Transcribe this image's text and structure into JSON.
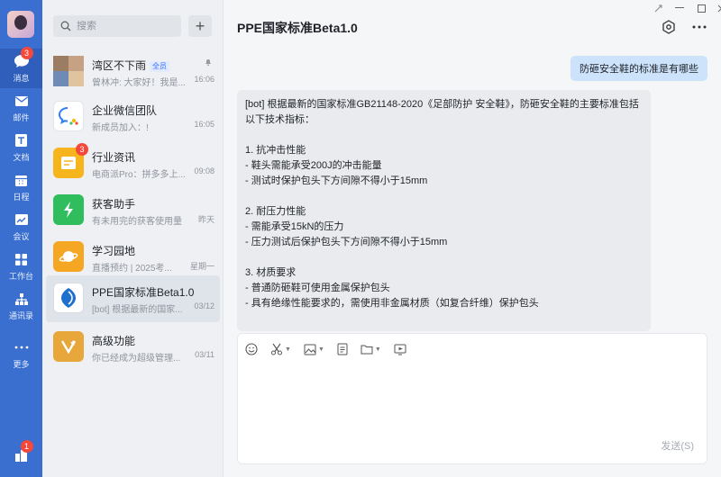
{
  "rail": {
    "items": [
      {
        "label": "消息",
        "badge": "3"
      },
      {
        "label": "邮件"
      },
      {
        "label": "文档"
      },
      {
        "label": "日程"
      },
      {
        "label": "会议"
      },
      {
        "label": "工作台"
      },
      {
        "label": "通讯录"
      },
      {
        "label": "更多"
      }
    ],
    "bottom_badge": "1",
    "accent": "#3a6fcf"
  },
  "search": {
    "placeholder": "搜索"
  },
  "add_label": "+",
  "conversations": [
    {
      "title": "湾区不下雨",
      "tag": "全员",
      "subtitle": "曾林冲: 大家好！我是...",
      "time": "16:06",
      "muted": true
    },
    {
      "title": "企业微信团队",
      "subtitle": "新成员加入：!",
      "time": "16:05"
    },
    {
      "title": "行业资讯",
      "subtitle": "电商派Pro：拼多多上...",
      "time": "09:08",
      "badge": "3"
    },
    {
      "title": "获客助手",
      "subtitle": "有未用完的获客使用量",
      "time": "昨天"
    },
    {
      "title": "学习园地",
      "subtitle": "直播预约 | 2025考...",
      "time": "星期一"
    },
    {
      "title": "PPE国家标准Beta1.0",
      "subtitle": "[bot] 根据最新的国家...",
      "time": "03/12",
      "selected": true
    },
    {
      "title": "高级功能",
      "subtitle": "你已经成为超级管理...",
      "time": "03/11"
    }
  ],
  "chat": {
    "title": "PPE国家标准Beta1.0",
    "user_message": "防砸安全鞋的标准是有哪些",
    "bot_message": "[bot] 根据最新的国家标准GB21148-2020《足部防护 安全鞋》，防砸安全鞋的主要标准包括以下技术指标：\n\n1. 抗冲击性能\n- 鞋头需能承受200J的冲击能量\n- 测试时保护包头下方间隙不得小于15mm\n\n2. 耐压力性能\n- 需能承受15kN的压力\n- 压力测试后保护包头下方间隙不得小于15mm\n\n3. 材质要求\n- 普通防砸鞋可使用金属保护包头\n- 具有绝缘性能要求的，需使用非金属材质（如复合纤维）保护包头",
    "send_label": "发送(S)"
  }
}
